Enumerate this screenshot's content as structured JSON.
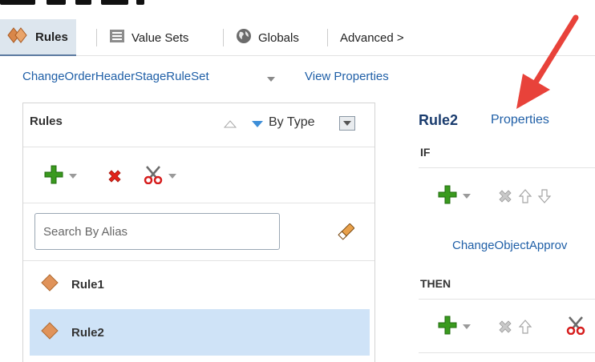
{
  "tabs": [
    {
      "label": "Rules",
      "icon": "rules-diamonds-icon",
      "active": true
    },
    {
      "label": "Value Sets",
      "icon": "list-icon",
      "active": false
    },
    {
      "label": "Globals",
      "icon": "globe-icon",
      "active": false
    },
    {
      "label": "Advanced >",
      "icon": "",
      "active": false
    }
  ],
  "breadcrumb": {
    "ruleset": "ChangeOrderHeaderStageRuleSet",
    "view_properties": "View Properties"
  },
  "left_panel": {
    "title": "Rules",
    "sort_label": "By Type",
    "search_placeholder": "Search By Alias",
    "rules": [
      {
        "label": "Rule1",
        "selected": false
      },
      {
        "label": "Rule2",
        "selected": true
      }
    ]
  },
  "right_panel": {
    "rule_name": "Rule2",
    "properties_link": "Properties",
    "if_label": "IF",
    "then_label": "THEN",
    "condition_link": "ChangeObjectApprov"
  },
  "colors": {
    "link": "#1f5fa7",
    "selected_row": "#cfe3f7",
    "active_tab": "#dde6ee",
    "add_green": "#3a9a1e",
    "delete_red": "#e2231a",
    "annotation_red": "#e8423a"
  }
}
